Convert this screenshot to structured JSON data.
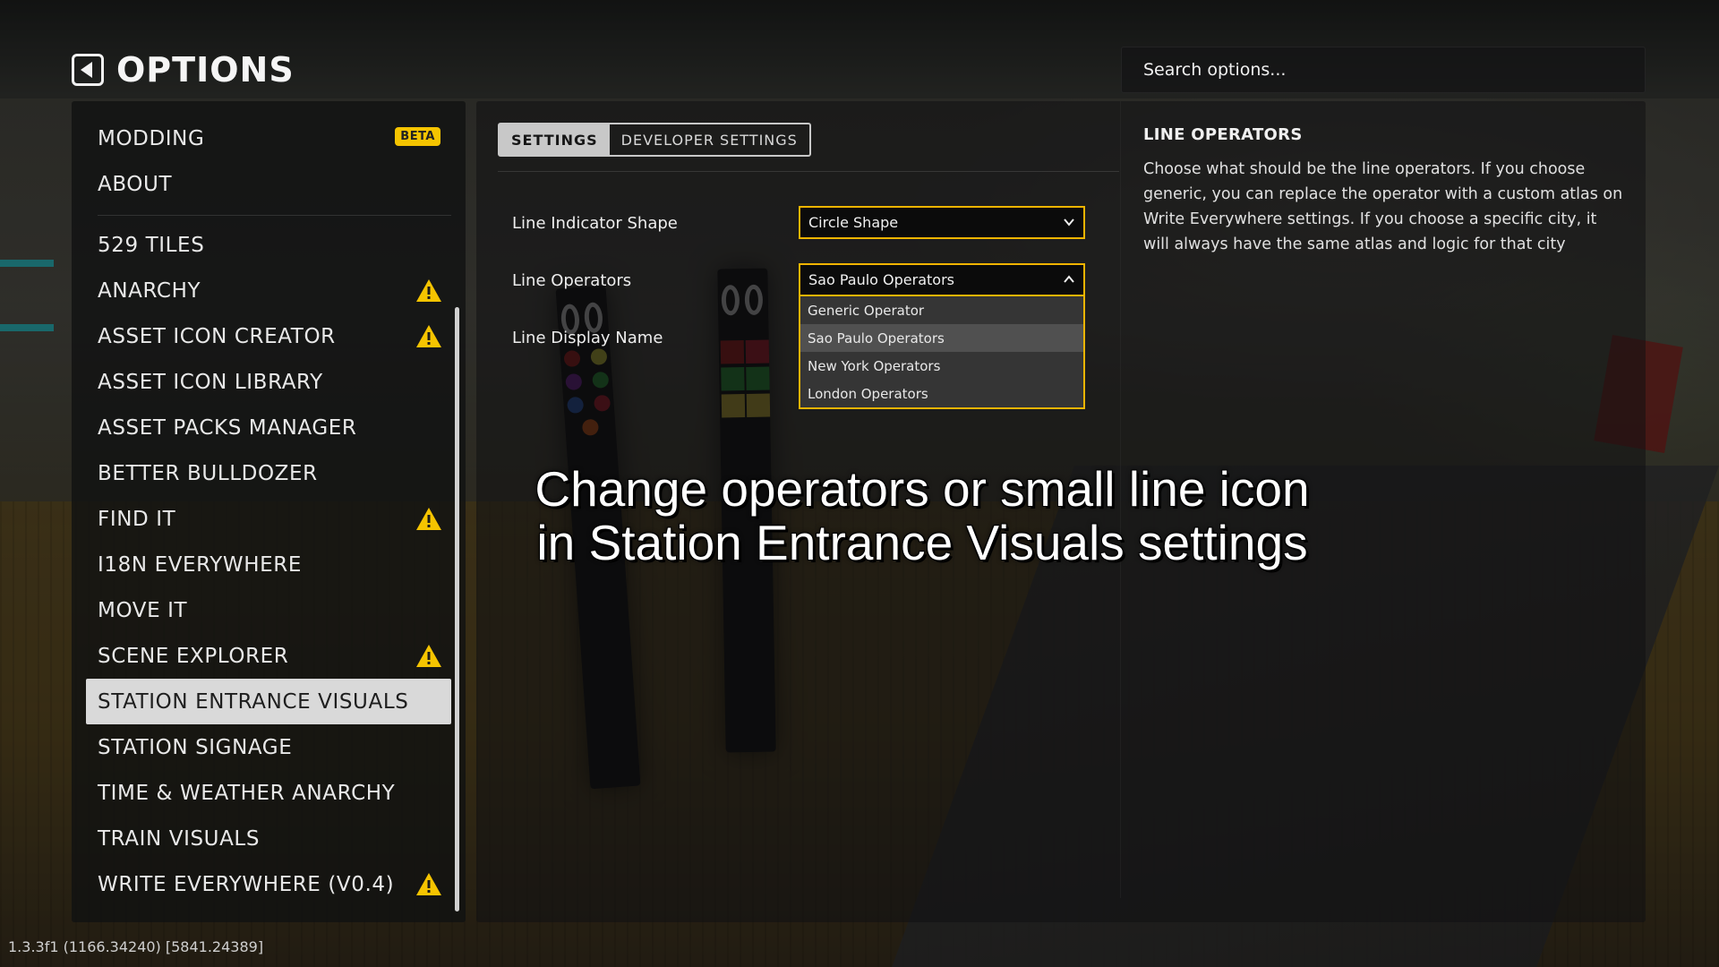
{
  "header": {
    "title": "OPTIONS",
    "search_placeholder": "Search options..."
  },
  "sidebar": {
    "items": [
      {
        "label": "MODDING",
        "badge": "BETA"
      },
      {
        "label": "ABOUT"
      },
      {
        "label": "529 TILES"
      },
      {
        "label": "ANARCHY",
        "warning": true
      },
      {
        "label": "ASSET ICON CREATOR",
        "warning": true
      },
      {
        "label": "ASSET ICON LIBRARY"
      },
      {
        "label": "ASSET PACKS MANAGER"
      },
      {
        "label": "BETTER BULLDOZER"
      },
      {
        "label": "FIND IT",
        "warning": true
      },
      {
        "label": "I18N EVERYWHERE"
      },
      {
        "label": "MOVE IT"
      },
      {
        "label": "SCENE EXPLORER",
        "warning": true
      },
      {
        "label": "STATION ENTRANCE VISUALS",
        "active": true
      },
      {
        "label": "STATION SIGNAGE"
      },
      {
        "label": "TIME & WEATHER ANARCHY"
      },
      {
        "label": "TRAIN VISUALS"
      },
      {
        "label": "WRITE EVERYWHERE (V0.4)",
        "warning": true
      }
    ]
  },
  "main": {
    "tabs": [
      {
        "label": "SETTINGS",
        "active": true
      },
      {
        "label": "DEVELOPER SETTINGS"
      }
    ],
    "settings": [
      {
        "label": "Line Indicator Shape",
        "value": "Circle Shape"
      },
      {
        "label": "Line Operators",
        "value": "Sao Paulo Operators"
      },
      {
        "label": "Line Display Name"
      }
    ],
    "dropdown_options": [
      {
        "label": "Generic Operator"
      },
      {
        "label": "Sao Paulo Operators",
        "selected": true
      },
      {
        "label": "New York Operators"
      },
      {
        "label": "London Operators"
      }
    ]
  },
  "help": {
    "title": "LINE OPERATORS",
    "text": "Choose what should be the line operators. If you choose generic, you can replace the operator with a custom atlas on Write Everywhere settings. If you choose a specific city, it will always have the same atlas and logic for that city"
  },
  "caption": {
    "line1": "Change operators or small line icon",
    "line2": "in Station Entrance Visuals settings"
  },
  "footer": {
    "version": "1.3.3f1 (1166.34240) [5841.24389]"
  },
  "colors": {
    "accent": "#f0b400",
    "beta_badge": "#f5c400",
    "warning": "#f5c400",
    "active_item_bg": "#d9d9d9"
  }
}
